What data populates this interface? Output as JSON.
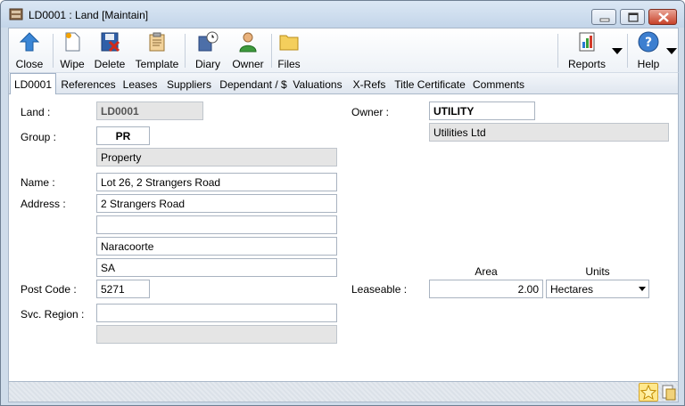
{
  "window": {
    "title": "LD0001 : Land [Maintain]",
    "icon": "cabinet-icon",
    "controls": [
      "minimize-icon",
      "maximize-icon",
      "close-icon"
    ]
  },
  "toolbar": {
    "buttons": [
      {
        "label": "Close",
        "icon": "up-arrow-icon"
      },
      {
        "label": "Wipe",
        "icon": "new-document-icon"
      },
      {
        "label": "Delete",
        "icon": "delete-floppy-icon"
      },
      {
        "label": "Template",
        "icon": "clipboard-icon"
      },
      {
        "label": "Diary",
        "icon": "diary-clock-icon"
      },
      {
        "label": "Owner",
        "icon": "person-icon"
      },
      {
        "label": "Files",
        "icon": "folder-icon"
      },
      {
        "label": "Reports",
        "icon": "report-chart-icon"
      },
      {
        "label": "Help",
        "icon": "help-icon"
      }
    ]
  },
  "tabs": [
    {
      "label": "LD0001",
      "active": true
    },
    {
      "label": "References"
    },
    {
      "label": "Leases"
    },
    {
      "label": "Suppliers"
    },
    {
      "label": "Dependant / $"
    },
    {
      "label": "Valuations"
    },
    {
      "label": "X-Refs"
    },
    {
      "label": "Title Certificate"
    },
    {
      "label": "Comments"
    }
  ],
  "form": {
    "land_label": "Land :",
    "land_value": "LD0001",
    "group_label": "Group :",
    "group_code": "PR",
    "group_desc": "Property",
    "name_label": "Name :",
    "name_value": "Lot 26, 2 Strangers Road",
    "address_label": "Address :",
    "address_lines": [
      "2 Strangers Road",
      "",
      "Naracoorte",
      "SA"
    ],
    "postcode_label": "Post Code :",
    "postcode_value": "5271",
    "svc_region_label": "Svc. Region :",
    "svc_region_value": "",
    "svc_region_desc": "",
    "owner_label": "Owner :",
    "owner_code": "UTILITY",
    "owner_name": "Utilities Ltd",
    "leaseable_label": "Leaseable :",
    "area_header": "Area",
    "units_header": "Units",
    "area_value": "2.00",
    "units_value": "Hectares"
  },
  "statusbar": {
    "icons": [
      "favorite-star-icon",
      "notes-icon"
    ]
  },
  "colors": {
    "titlebar": "#cfdcea",
    "readonly_field": "#e5e5e5",
    "close_button": "#c8432a"
  }
}
